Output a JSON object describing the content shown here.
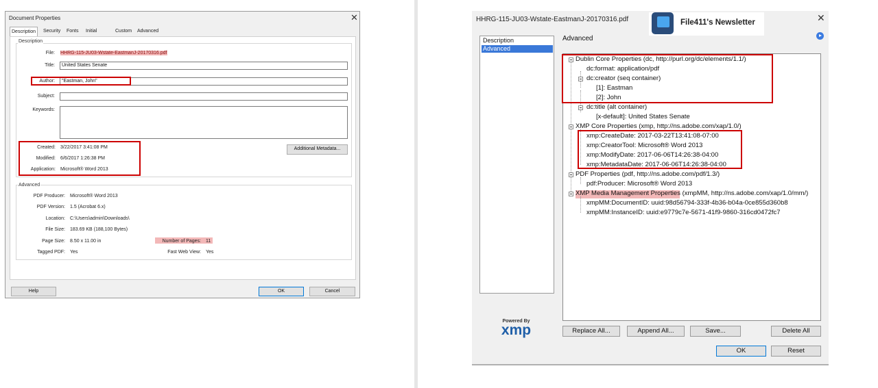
{
  "left": {
    "title": "Document Properties",
    "close": "✕",
    "tabs": [
      "Description",
      "Security",
      "Fonts",
      "Initial View",
      "Custom",
      "Advanced"
    ],
    "description": {
      "group_label": "Description",
      "file_label": "File:",
      "file_value": "HHRG-115-JU03-Wstate-EastmanJ-20170316.pdf",
      "title_label": "Title:",
      "title_value": "United States Senate",
      "author_label": "Author:",
      "author_value": "\"Eastman, John\"",
      "subject_label": "Subject:",
      "subject_value": "",
      "keywords_label": "Keywords:",
      "keywords_value": "",
      "created_label": "Created:",
      "created_value": "3/22/2017 3:41:08 PM",
      "modified_label": "Modified:",
      "modified_value": "6/6/2017 1:26:38 PM",
      "application_label": "Application:",
      "application_value": "Microsoft® Word 2013",
      "additional_metadata": "Additional Metadata..."
    },
    "advanced": {
      "group_label": "Advanced",
      "producer_label": "PDF Producer:",
      "producer_value": "Microsoft® Word 2013",
      "version_label": "PDF Version:",
      "version_value": "1.5 (Acrobat 6.x)",
      "location_label": "Location:",
      "location_value": "C:\\Users\\admin\\Downloads\\",
      "filesize_label": "File Size:",
      "filesize_value": "183.69 KB (188,100 Bytes)",
      "pagesize_label": "Page Size:",
      "pagesize_value": "8.50 x 11.00 in",
      "pages_label": "Number of Pages:",
      "pages_value": "11",
      "tagged_label": "Tagged PDF:",
      "tagged_value": "Yes",
      "fastweb_label": "Fast Web View:",
      "fastweb_value": "Yes"
    },
    "buttons": {
      "help": "Help",
      "ok": "OK",
      "cancel": "Cancel"
    }
  },
  "right": {
    "title": "HHRG-115-JU03-Wstate-EastmanJ-20170316.pdf",
    "close": "✕",
    "newsletter": "File411's Newsletter",
    "nav": [
      "Description",
      "Advanced"
    ],
    "section_title": "Advanced",
    "tree": [
      "Dublin Core Properties (dc, http://purl.org/dc/elements/1.1/)",
      "dc:format: application/pdf",
      "dc:creator (seq container)",
      "[1]: Eastman",
      "[2]: John",
      "dc:title (alt container)",
      "[x-default]: United States Senate",
      "XMP Core Properties (xmp, http://ns.adobe.com/xap/1.0/)",
      "xmp:CreateDate: 2017-03-22T13:41:08-07:00",
      "xmp:CreatorTool: Microsoft® Word 2013",
      "xmp:ModifyDate: 2017-06-06T14:26:38-04:00",
      "xmp:MetadataDate: 2017-06-06T14:26:38-04:00",
      "PDF Properties (pdf, http://ns.adobe.com/pdf/1.3/)",
      "pdf:Producer: Microsoft® Word 2013",
      "XMP Media Management Properties (xmpMM, http://ns.adobe.com/xap/1.0/mm/)",
      "xmpMM:DocumentID: uuid:98d56794-333f-4b36-b04a-0ce855d360b8",
      "xmpMM:InstanceID: uuid:e9779c7e-5671-41f9-9860-316cd0472fc7"
    ],
    "xmp_powered": "Powered By",
    "xmp_logo": "xmp",
    "buttons": {
      "replace_all": "Replace All...",
      "append_all": "Append All...",
      "save": "Save...",
      "delete_all": "Delete All",
      "ok": "OK",
      "reset": "Reset"
    }
  }
}
